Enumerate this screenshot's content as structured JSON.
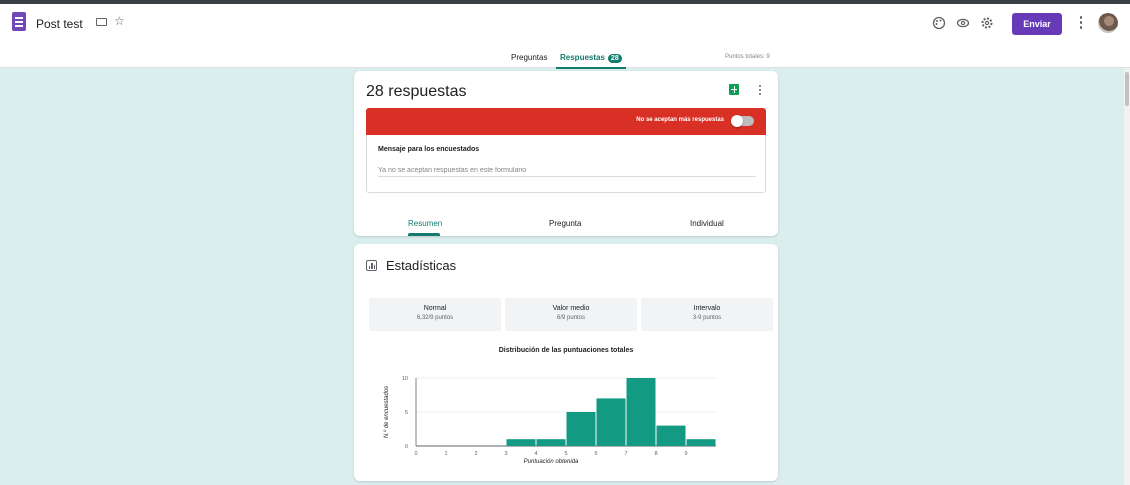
{
  "header": {
    "title": "Post test",
    "send_label": "Enviar"
  },
  "tabs": {
    "questions": "Preguntas",
    "responses": "Respuestas",
    "responses_badge": "28",
    "total_points": "Puntos totales: 9"
  },
  "responses_card": {
    "count_label": "28 respuestas",
    "accepting_label": "No se aceptan más respuestas",
    "accepting_enabled": false,
    "message_label": "Mensaje para los encuestados",
    "message_value": "",
    "message_placeholder": "Ya no se aceptan respuestas en este formulario",
    "subtabs": [
      "Resumen",
      "Pregunta",
      "Individual"
    ]
  },
  "stats_card": {
    "title": "Estadísticas",
    "boxes": [
      {
        "name": "Normal",
        "value": "6,32/9 puntos"
      },
      {
        "name": "Valor medio",
        "value": "6/9 puntos"
      },
      {
        "name": "Intervalo",
        "value": "3-9 puntos"
      }
    ]
  },
  "colors": {
    "accent": "#673ab7",
    "teal": "#137a6c",
    "bar": "#129a82",
    "red": "#d93025",
    "background": "#dbeeee"
  },
  "icons": [
    "forms-app-icon",
    "folder-icon",
    "star-icon",
    "palette-icon",
    "eye-icon",
    "settings-icon",
    "more-vert-icon",
    "sheets-icon",
    "bar-chart-icon"
  ],
  "chart_data": {
    "type": "bar",
    "title": "Distribución de las puntuaciones totales",
    "xlabel": "Puntuación obtenida",
    "ylabel": "N.º de encuestados",
    "x": [
      0,
      1,
      2,
      3,
      4,
      5,
      6,
      7,
      8,
      9
    ],
    "values": [
      0,
      0,
      0,
      1,
      1,
      5,
      7,
      10,
      3,
      1
    ],
    "yticks": [
      0,
      5,
      10
    ],
    "ylim": [
      0,
      10
    ],
    "grid": true
  }
}
